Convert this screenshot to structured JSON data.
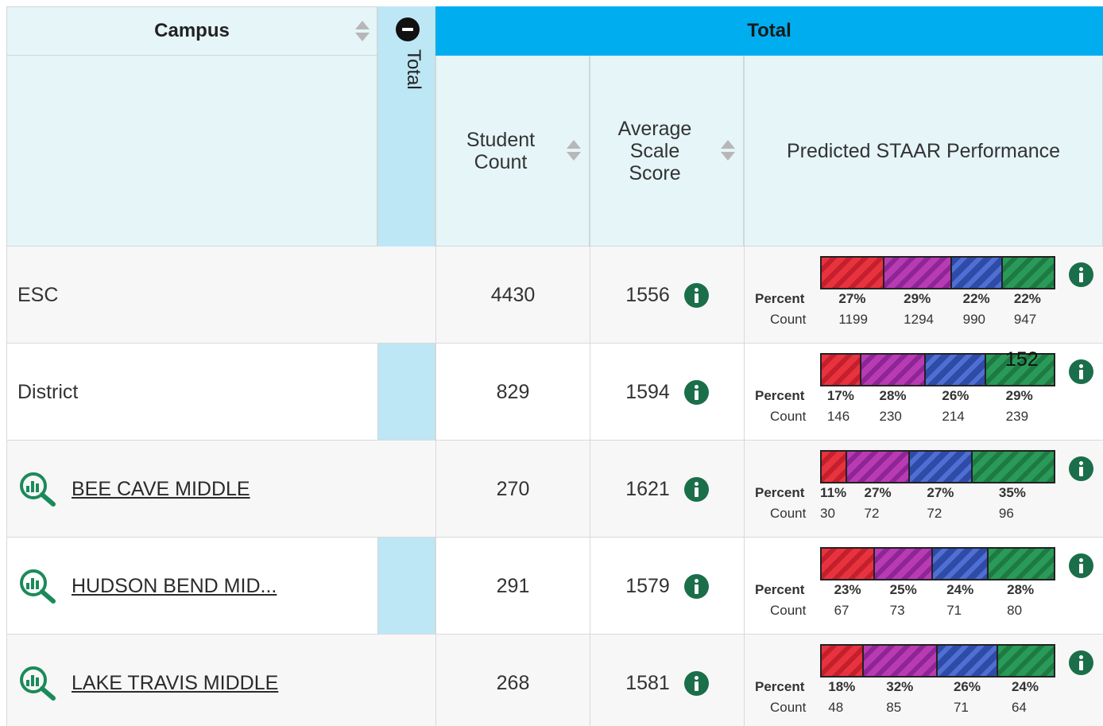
{
  "header": {
    "campus_label": "Campus",
    "strip_label": "Total",
    "total_label": "Total",
    "col_student_count": "Student Count",
    "col_avg_score": "Average Scale Score",
    "col_performance": "Predicted STAAR Performance"
  },
  "labels": {
    "percent": "Percent",
    "count": "Count"
  },
  "colors": {
    "header_blue": "#00aeef",
    "strip_light_blue": "#bde7f5",
    "header_bg": "#e5f5f8",
    "info_green": "#1b6e4a",
    "seg_red": "#e8333f",
    "seg_purple": "#b83bb3",
    "seg_blue": "#2f4ba8",
    "seg_green": "#2a9a58"
  },
  "rows": [
    {
      "campus": "ESC",
      "is_link": false,
      "student_count": "4430",
      "avg_score": "1556",
      "segments": [
        {
          "color": "red",
          "fraction": 0.27,
          "percent": "27%",
          "count": "1199"
        },
        {
          "color": "purple",
          "fraction": 0.29,
          "percent": "29%",
          "count": "1294"
        },
        {
          "color": "blue",
          "fraction": 0.22,
          "percent": "22%",
          "count": "990"
        },
        {
          "color": "green",
          "fraction": 0.22,
          "percent": "22%",
          "count": "947"
        }
      ]
    },
    {
      "campus": "District",
      "is_link": false,
      "student_count": "829",
      "avg_score": "1594",
      "bar_overlay_text": "152",
      "segments": [
        {
          "color": "red",
          "fraction": 0.17,
          "percent": "17%",
          "count": "146"
        },
        {
          "color": "purple",
          "fraction": 0.28,
          "percent": "28%",
          "count": "230"
        },
        {
          "color": "blue",
          "fraction": 0.26,
          "percent": "26%",
          "count": "214"
        },
        {
          "color": "green",
          "fraction": 0.29,
          "percent": "29%",
          "count": "239"
        }
      ]
    },
    {
      "campus": "BEE CAVE MIDDLE",
      "is_link": true,
      "student_count": "270",
      "avg_score": "1621",
      "segments": [
        {
          "color": "red",
          "fraction": 0.11,
          "percent": "11%",
          "count": "30"
        },
        {
          "color": "purple",
          "fraction": 0.27,
          "percent": "27%",
          "count": "72"
        },
        {
          "color": "blue",
          "fraction": 0.27,
          "percent": "27%",
          "count": "72"
        },
        {
          "color": "green",
          "fraction": 0.35,
          "percent": "35%",
          "count": "96"
        }
      ]
    },
    {
      "campus": "HUDSON BEND MID...",
      "is_link": true,
      "student_count": "291",
      "avg_score": "1579",
      "segments": [
        {
          "color": "red",
          "fraction": 0.23,
          "percent": "23%",
          "count": "67"
        },
        {
          "color": "purple",
          "fraction": 0.25,
          "percent": "25%",
          "count": "73"
        },
        {
          "color": "blue",
          "fraction": 0.24,
          "percent": "24%",
          "count": "71"
        },
        {
          "color": "green",
          "fraction": 0.28,
          "percent": "28%",
          "count": "80"
        }
      ]
    },
    {
      "campus": "LAKE TRAVIS MIDDLE",
      "is_link": true,
      "student_count": "268",
      "avg_score": "1581",
      "segments": [
        {
          "color": "red",
          "fraction": 0.18,
          "percent": "18%",
          "count": "48"
        },
        {
          "color": "purple",
          "fraction": 0.32,
          "percent": "32%",
          "count": "85"
        },
        {
          "color": "blue",
          "fraction": 0.26,
          "percent": "26%",
          "count": "71"
        },
        {
          "color": "green",
          "fraction": 0.24,
          "percent": "24%",
          "count": "64"
        }
      ]
    }
  ]
}
